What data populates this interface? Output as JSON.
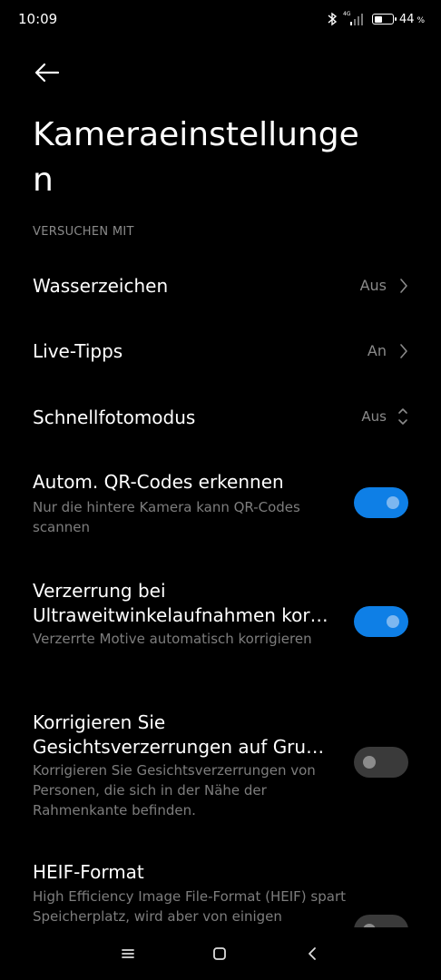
{
  "status_bar": {
    "time": "10:09",
    "network_label": "4G",
    "battery_percent": "44",
    "battery_level": 0.44
  },
  "header": {
    "back_icon": "arrow-left-icon",
    "title": "Kameraeinstellungen"
  },
  "section": {
    "header": "VERSUCHEN MIT"
  },
  "settings": {
    "watermark": {
      "title": "Wasserzeichen",
      "value": "Aus"
    },
    "live_tips": {
      "title": "Live-Tipps",
      "value": "An"
    },
    "quick_photo": {
      "title": "Schnellfotomodus",
      "value": "Aus"
    },
    "qr_codes": {
      "title": "Autom. QR-Codes erkennen",
      "description": "Nur die hintere Kamera kann QR-Codes scannen",
      "enabled": true
    },
    "ultrawide_correction": {
      "title_line1": "Verzerrung bei",
      "title_line2": "Ultraweitwinkelaufnahmen kor…",
      "description": "Verzerrte Motive automatisch korrigieren",
      "enabled": true
    },
    "face_correction": {
      "title_line1": "Korrigieren Sie",
      "title_line2": "Gesichtsverzerrungen auf Gru…",
      "description": "Korrigieren Sie Gesichtsverzerrungen von Personen, die sich in der Nähe der Rahmenkante befinden.",
      "enabled": false
    },
    "heif": {
      "title": "HEIF-Format",
      "description": "High Efficiency Image File-Format (HEIF) spart Speicherplatz, wird aber von einigen",
      "enabled": false
    }
  },
  "nav_bar": {
    "menu_icon": "menu-icon",
    "home_icon": "home-icon",
    "back_icon": "back-triangle-icon"
  },
  "colors": {
    "background": "#000000",
    "toggle_on": "#0e7fe6",
    "toggle_off": "#3a3a3a",
    "secondary_text": "#8a8a8a"
  }
}
